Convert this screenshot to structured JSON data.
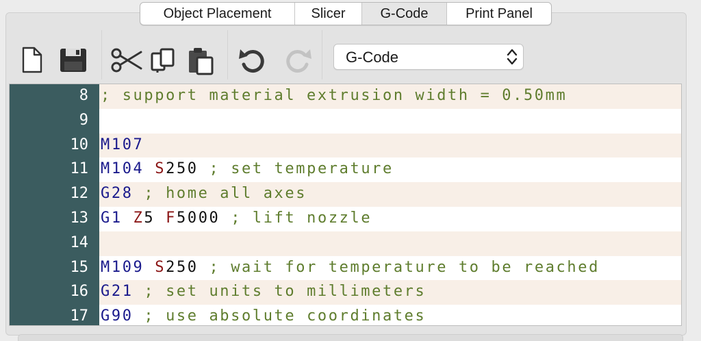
{
  "tabs": [
    {
      "label": "Object Placement",
      "active": false
    },
    {
      "label": "Slicer",
      "active": false
    },
    {
      "label": "G-Code",
      "active": true
    },
    {
      "label": "Print Panel",
      "active": false
    }
  ],
  "toolbar": {
    "icons": [
      "new-document-icon",
      "save-disk-icon",
      "cut-scissors-icon",
      "copy-icon",
      "paste-icon",
      "undo-icon",
      "redo-icon"
    ],
    "select_value": "G-Code"
  },
  "editor": {
    "lines": [
      {
        "n": "8",
        "tokens": [
          {
            "t": "; support material extrusion width = 0.50mm",
            "k": "com"
          }
        ]
      },
      {
        "n": "9",
        "tokens": []
      },
      {
        "n": "10",
        "tokens": [
          {
            "t": "M107",
            "k": "cmd"
          }
        ]
      },
      {
        "n": "11",
        "tokens": [
          {
            "t": "M104",
            "k": "cmd"
          },
          {
            "t": " ",
            "k": "num"
          },
          {
            "t": "S",
            "k": "par"
          },
          {
            "t": "250",
            "k": "num"
          },
          {
            "t": " ; set temperature",
            "k": "com"
          }
        ]
      },
      {
        "n": "12",
        "tokens": [
          {
            "t": "G28",
            "k": "cmd"
          },
          {
            "t": " ; home all axes",
            "k": "com"
          }
        ]
      },
      {
        "n": "13",
        "tokens": [
          {
            "t": "G1",
            "k": "cmd"
          },
          {
            "t": " ",
            "k": "num"
          },
          {
            "t": "Z",
            "k": "par"
          },
          {
            "t": "5",
            "k": "num"
          },
          {
            "t": " ",
            "k": "num"
          },
          {
            "t": "F",
            "k": "par"
          },
          {
            "t": "5000",
            "k": "num"
          },
          {
            "t": " ; lift nozzle",
            "k": "com"
          }
        ]
      },
      {
        "n": "14",
        "tokens": []
      },
      {
        "n": "15",
        "tokens": [
          {
            "t": "M109",
            "k": "cmd"
          },
          {
            "t": " ",
            "k": "num"
          },
          {
            "t": "S",
            "k": "par"
          },
          {
            "t": "250",
            "k": "num"
          },
          {
            "t": " ; wait for temperature to be reached",
            "k": "com"
          }
        ]
      },
      {
        "n": "16",
        "tokens": [
          {
            "t": "G21",
            "k": "cmd"
          },
          {
            "t": " ; set units to millimeters",
            "k": "com"
          }
        ]
      },
      {
        "n": "17",
        "tokens": [
          {
            "t": "G90",
            "k": "cmd"
          },
          {
            "t": " ; use absolute coordinates",
            "k": "com"
          }
        ]
      }
    ]
  }
}
